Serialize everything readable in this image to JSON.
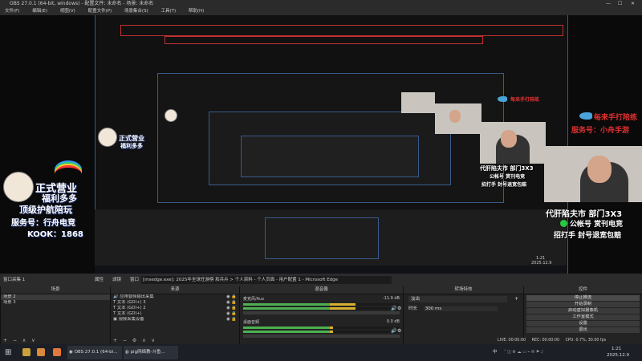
{
  "window": {
    "title": "OBS 27.0.1 (64-bit, windows) - 配置文件: 未命名 - 场景: 未命名",
    "min": "—",
    "max": "☐",
    "close": "✕"
  },
  "menu": [
    "文件(F)",
    "编辑(E)",
    "视图(V)",
    "配置文件(P)",
    "场景集合(S)",
    "工具(T)",
    "帮助(H)"
  ],
  "preview_overlay": {
    "promo_lines": [
      "正式营业",
      "福利多多",
      "顶级护航陪玩",
      "服务号：行舟电竞",
      "KOOK：1868"
    ],
    "right_lines": [
      "代肝陷夫市 部门3X3",
      "公帐号 赏刊电竞",
      "招打手 封号退宽包赔"
    ],
    "red_lines": [
      "每来手打陪练",
      "服务号：小舟手游"
    ],
    "inner_clock": "1:21",
    "inner_date": "2025.12.9"
  },
  "status_strip": {
    "capture": "窗口采集 1",
    "properties": "属性",
    "filters": "滤镜",
    "window_label": "窗口",
    "window_value": "[msedge.exe]: 2025年全球任游榜 和兵卉 > 个人资料 - 个人页面 - 用户配置 1 - Microsoft Edge"
  },
  "scenes": {
    "header": "场景",
    "items": [
      "场景 2",
      "场景 3"
    ]
  },
  "sources": {
    "header": "来源",
    "items": [
      "应用音频输出采集",
      "文本 (GDI+) 3",
      "文本 (GDI+) 2",
      "文本 (GDI+)",
      "视频采集设备"
    ]
  },
  "mixer": {
    "header": "混音器",
    "channels": [
      {
        "name": "麦克风/Aux",
        "db": "-11.9 dB",
        "level": 0.78
      },
      {
        "name": "桌面音频",
        "db": "0.0 dB",
        "level": 0.62
      }
    ],
    "scale": [
      "-60",
      "-55",
      "-50",
      "-45",
      "-40",
      "-35",
      "-30",
      "-25",
      "-20",
      "-15",
      "-10",
      "-5",
      "0"
    ]
  },
  "transitions": {
    "header": "转场特效",
    "type": "淡出",
    "duration_label": "时长",
    "duration": "300 ms"
  },
  "controls": {
    "header": "控件",
    "buttons": [
      "停止推流",
      "开始录制",
      "启动虚拟摄像机",
      "工作室模式",
      "设置",
      "退出"
    ]
  },
  "statusbar": {
    "live": "LIVE: 00:00:00",
    "rec": "REC: 00:00:00",
    "cpu": "CPU: 0.7%, 30.00 fps"
  },
  "taskbar": {
    "items": [
      "OBS 27.0.1 (64-bi...",
      "pig网络教-斗鱼..."
    ],
    "ime": "中",
    "time": "1:21",
    "date": "2025.12.9"
  },
  "colors": {
    "accent": "#3a5a8a",
    "recursion_red": "#c03030",
    "meter_green": "#4cb050"
  }
}
